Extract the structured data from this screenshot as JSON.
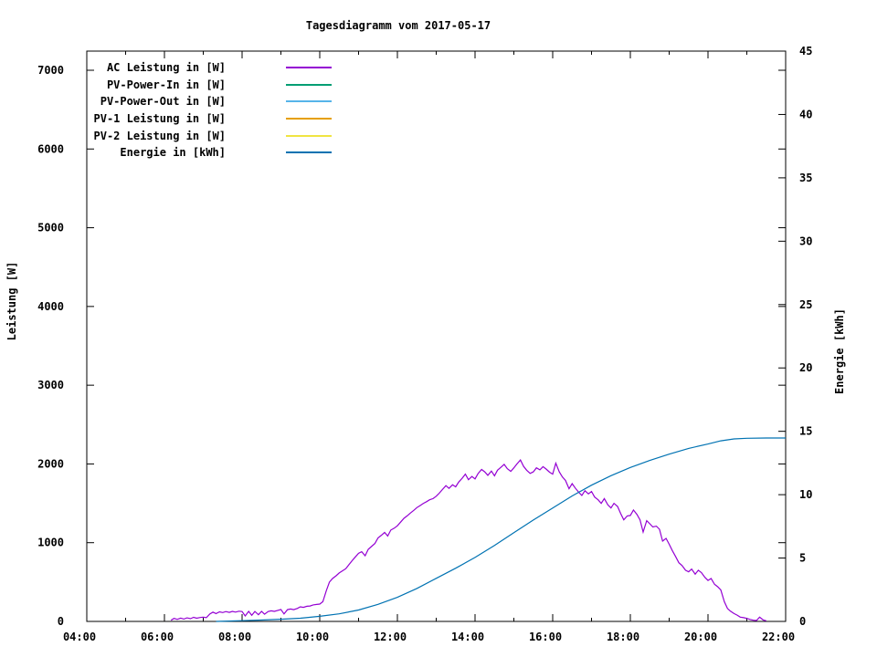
{
  "page": {
    "background": "#ffffff",
    "plot_background": "#ffffff",
    "border_color": "#000000"
  },
  "chart_data": {
    "type": "line",
    "title": "Tagesdiagramm vom 2017-05-17",
    "grid": false,
    "legend_position": "top-left-inside",
    "x_axis": {
      "label": "",
      "unit": "time",
      "min_hour": 4,
      "max_hour": 22,
      "major_ticks": [
        {
          "hour": 4,
          "label": "04:00"
        },
        {
          "hour": 6,
          "label": "06:00"
        },
        {
          "hour": 8,
          "label": "08:00"
        },
        {
          "hour": 10,
          "label": "10:00"
        },
        {
          "hour": 12,
          "label": "12:00"
        },
        {
          "hour": 14,
          "label": "14:00"
        },
        {
          "hour": 16,
          "label": "16:00"
        },
        {
          "hour": 18,
          "label": "18:00"
        },
        {
          "hour": 20,
          "label": "20:00"
        },
        {
          "hour": 22,
          "label": "22:00"
        }
      ],
      "minor_tick_hours": [
        5,
        7,
        9,
        11,
        13,
        15,
        17,
        19,
        21
      ]
    },
    "y1_axis": {
      "label": "Leistung [W]",
      "min": 0,
      "max": 7000,
      "tick_step": 1000,
      "ticks": [
        0,
        1000,
        2000,
        3000,
        4000,
        5000,
        6000,
        7000
      ]
    },
    "y2_axis": {
      "label": "Energie [kWh]",
      "min": 0,
      "max": 45,
      "tick_step": 5,
      "ticks": [
        0,
        5,
        10,
        15,
        20,
        25,
        30,
        35,
        40,
        45
      ]
    },
    "series": [
      {
        "name": "AC Leistung in [W]",
        "color": "#9400d3",
        "axis": "y1",
        "points": [
          [
            6.17,
            15
          ],
          [
            6.25,
            38
          ],
          [
            6.33,
            25
          ],
          [
            6.42,
            42
          ],
          [
            6.5,
            30
          ],
          [
            6.58,
            45
          ],
          [
            6.67,
            35
          ],
          [
            6.75,
            52
          ],
          [
            6.83,
            40
          ],
          [
            6.92,
            50
          ],
          [
            7.0,
            55
          ],
          [
            7.08,
            48
          ],
          [
            7.17,
            95
          ],
          [
            7.25,
            118
          ],
          [
            7.33,
            100
          ],
          [
            7.42,
            122
          ],
          [
            7.5,
            112
          ],
          [
            7.58,
            125
          ],
          [
            7.67,
            115
          ],
          [
            7.75,
            128
          ],
          [
            7.83,
            118
          ],
          [
            7.92,
            130
          ],
          [
            8.0,
            125
          ],
          [
            8.08,
            70
          ],
          [
            8.17,
            128
          ],
          [
            8.25,
            78
          ],
          [
            8.33,
            126
          ],
          [
            8.42,
            85
          ],
          [
            8.5,
            128
          ],
          [
            8.58,
            92
          ],
          [
            8.67,
            125
          ],
          [
            8.75,
            135
          ],
          [
            8.83,
            128
          ],
          [
            8.92,
            140
          ],
          [
            9.0,
            152
          ],
          [
            9.08,
            95
          ],
          [
            9.17,
            150
          ],
          [
            9.25,
            158
          ],
          [
            9.33,
            150
          ],
          [
            9.42,
            165
          ],
          [
            9.5,
            185
          ],
          [
            9.58,
            178
          ],
          [
            9.67,
            192
          ],
          [
            9.75,
            196
          ],
          [
            9.83,
            210
          ],
          [
            9.92,
            215
          ],
          [
            10.0,
            220
          ],
          [
            10.08,
            250
          ],
          [
            10.17,
            390
          ],
          [
            10.25,
            500
          ],
          [
            10.33,
            545
          ],
          [
            10.42,
            580
          ],
          [
            10.5,
            615
          ],
          [
            10.58,
            640
          ],
          [
            10.67,
            670
          ],
          [
            10.75,
            720
          ],
          [
            10.83,
            770
          ],
          [
            10.92,
            820
          ],
          [
            11.0,
            865
          ],
          [
            11.08,
            885
          ],
          [
            11.17,
            835
          ],
          [
            11.25,
            915
          ],
          [
            11.33,
            950
          ],
          [
            11.42,
            990
          ],
          [
            11.5,
            1060
          ],
          [
            11.58,
            1090
          ],
          [
            11.67,
            1130
          ],
          [
            11.75,
            1085
          ],
          [
            11.83,
            1160
          ],
          [
            11.92,
            1185
          ],
          [
            12.0,
            1215
          ],
          [
            12.08,
            1260
          ],
          [
            12.17,
            1310
          ],
          [
            12.25,
            1340
          ],
          [
            12.33,
            1375
          ],
          [
            12.42,
            1410
          ],
          [
            12.5,
            1445
          ],
          [
            12.58,
            1470
          ],
          [
            12.67,
            1500
          ],
          [
            12.75,
            1520
          ],
          [
            12.83,
            1545
          ],
          [
            12.92,
            1560
          ],
          [
            13.0,
            1590
          ],
          [
            13.08,
            1630
          ],
          [
            13.17,
            1680
          ],
          [
            13.25,
            1725
          ],
          [
            13.33,
            1690
          ],
          [
            13.42,
            1735
          ],
          [
            13.5,
            1710
          ],
          [
            13.58,
            1770
          ],
          [
            13.67,
            1820
          ],
          [
            13.75,
            1870
          ],
          [
            13.83,
            1800
          ],
          [
            13.92,
            1840
          ],
          [
            14.0,
            1810
          ],
          [
            14.08,
            1880
          ],
          [
            14.17,
            1930
          ],
          [
            14.25,
            1900
          ],
          [
            14.33,
            1855
          ],
          [
            14.42,
            1910
          ],
          [
            14.5,
            1850
          ],
          [
            14.58,
            1920
          ],
          [
            14.67,
            1960
          ],
          [
            14.75,
            1995
          ],
          [
            14.83,
            1940
          ],
          [
            14.92,
            1905
          ],
          [
            15.0,
            1950
          ],
          [
            15.08,
            2000
          ],
          [
            15.17,
            2050
          ],
          [
            15.25,
            1970
          ],
          [
            15.33,
            1920
          ],
          [
            15.42,
            1880
          ],
          [
            15.5,
            1900
          ],
          [
            15.58,
            1950
          ],
          [
            15.67,
            1925
          ],
          [
            15.75,
            1965
          ],
          [
            15.83,
            1935
          ],
          [
            15.92,
            1895
          ],
          [
            16.0,
            1870
          ],
          [
            16.08,
            2010
          ],
          [
            16.17,
            1900
          ],
          [
            16.25,
            1835
          ],
          [
            16.33,
            1790
          ],
          [
            16.42,
            1685
          ],
          [
            16.5,
            1750
          ],
          [
            16.58,
            1695
          ],
          [
            16.67,
            1640
          ],
          [
            16.75,
            1600
          ],
          [
            16.83,
            1660
          ],
          [
            16.92,
            1620
          ],
          [
            17.0,
            1650
          ],
          [
            17.08,
            1580
          ],
          [
            17.17,
            1545
          ],
          [
            17.25,
            1500
          ],
          [
            17.33,
            1560
          ],
          [
            17.42,
            1480
          ],
          [
            17.5,
            1440
          ],
          [
            17.58,
            1500
          ],
          [
            17.67,
            1460
          ],
          [
            17.75,
            1370
          ],
          [
            17.83,
            1290
          ],
          [
            17.92,
            1340
          ],
          [
            18.0,
            1345
          ],
          [
            18.08,
            1415
          ],
          [
            18.17,
            1360
          ],
          [
            18.25,
            1290
          ],
          [
            18.33,
            1135
          ],
          [
            18.42,
            1280
          ],
          [
            18.5,
            1240
          ],
          [
            18.58,
            1200
          ],
          [
            18.67,
            1210
          ],
          [
            18.75,
            1170
          ],
          [
            18.83,
            1020
          ],
          [
            18.92,
            1055
          ],
          [
            19.0,
            980
          ],
          [
            19.08,
            900
          ],
          [
            19.17,
            820
          ],
          [
            19.25,
            745
          ],
          [
            19.33,
            710
          ],
          [
            19.42,
            650
          ],
          [
            19.5,
            630
          ],
          [
            19.58,
            665
          ],
          [
            19.67,
            600
          ],
          [
            19.75,
            650
          ],
          [
            19.83,
            620
          ],
          [
            19.92,
            560
          ],
          [
            20.0,
            520
          ],
          [
            20.08,
            545
          ],
          [
            20.17,
            470
          ],
          [
            20.25,
            440
          ],
          [
            20.33,
            400
          ],
          [
            20.42,
            250
          ],
          [
            20.5,
            165
          ],
          [
            20.58,
            130
          ],
          [
            20.67,
            100
          ],
          [
            20.75,
            80
          ],
          [
            20.83,
            55
          ],
          [
            20.92,
            48
          ],
          [
            21.0,
            38
          ],
          [
            21.08,
            25
          ],
          [
            21.17,
            15
          ],
          [
            21.25,
            12
          ],
          [
            21.33,
            55
          ],
          [
            21.42,
            18
          ],
          [
            21.5,
            8
          ]
        ]
      },
      {
        "name": "PV-Power-In in [W]",
        "color": "#009e73",
        "axis": "y1",
        "points": []
      },
      {
        "name": "PV-Power-Out in [W]",
        "color": "#56b4e9",
        "axis": "y1",
        "points": []
      },
      {
        "name": "PV-1 Leistung in [W]",
        "color": "#e69f00",
        "axis": "y1",
        "points": []
      },
      {
        "name": "PV-2 Leistung in [W]",
        "color": "#f0e442",
        "axis": "y1",
        "points": []
      },
      {
        "name": "Energie in [kWh]",
        "color": "#0072b2",
        "axis": "y2",
        "points": [
          [
            7.33,
            0.0
          ],
          [
            7.67,
            0.03
          ],
          [
            8.0,
            0.06
          ],
          [
            8.5,
            0.11
          ],
          [
            9.0,
            0.17
          ],
          [
            9.5,
            0.25
          ],
          [
            10.0,
            0.4
          ],
          [
            10.5,
            0.6
          ],
          [
            11.0,
            0.9
          ],
          [
            11.5,
            1.35
          ],
          [
            12.0,
            1.9
          ],
          [
            12.5,
            2.6
          ],
          [
            13.0,
            3.4
          ],
          [
            13.5,
            4.2
          ],
          [
            14.0,
            5.05
          ],
          [
            14.5,
            6.0
          ],
          [
            15.0,
            7.0
          ],
          [
            15.5,
            8.0
          ],
          [
            16.0,
            8.95
          ],
          [
            16.5,
            9.9
          ],
          [
            17.0,
            10.75
          ],
          [
            17.5,
            11.5
          ],
          [
            18.0,
            12.15
          ],
          [
            18.5,
            12.7
          ],
          [
            19.0,
            13.2
          ],
          [
            19.5,
            13.65
          ],
          [
            20.0,
            14.0
          ],
          [
            20.33,
            14.25
          ],
          [
            20.67,
            14.4
          ],
          [
            21.0,
            14.45
          ],
          [
            21.5,
            14.47
          ],
          [
            22.0,
            14.47
          ]
        ]
      }
    ]
  }
}
